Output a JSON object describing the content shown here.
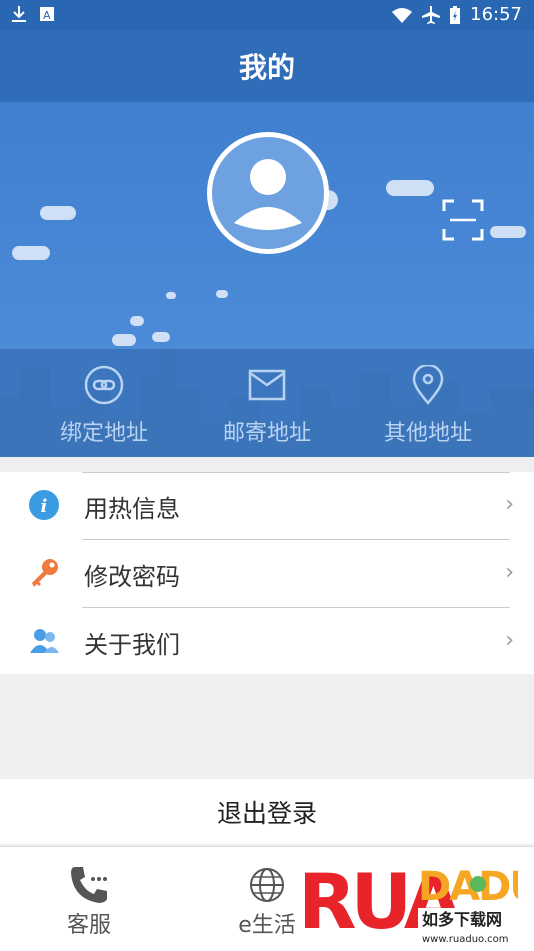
{
  "status_bar": {
    "time": "16:57",
    "icons": [
      "download-icon",
      "a-badge-icon",
      "wifi-icon",
      "airplane-icon",
      "battery-icon"
    ]
  },
  "header": {
    "title": "我的"
  },
  "hero": {
    "avatar_icon": "user-avatar-icon",
    "scan_icon": "scan-icon"
  },
  "address_tabs": [
    {
      "label": "绑定地址",
      "icon": "link-icon"
    },
    {
      "label": "邮寄地址",
      "icon": "mail-icon"
    },
    {
      "label": "其他地址",
      "icon": "location-pin-icon"
    }
  ],
  "menu": [
    {
      "label": "用热信息",
      "icon": "info-icon"
    },
    {
      "label": "修改密码",
      "icon": "key-icon"
    },
    {
      "label": "关于我们",
      "icon": "people-icon"
    }
  ],
  "logout_label": "退出登录",
  "tabbar": [
    {
      "label": "客服",
      "icon": "phone-icon"
    },
    {
      "label": "e生活",
      "icon": "globe-icon"
    }
  ],
  "watermark": {
    "brand": "RUANDADUO",
    "sub": "如多下载网",
    "url": "www.ruaduo.com"
  },
  "colors": {
    "primary": "#2f6db9",
    "hero": "#4a89d6",
    "menu_text": "#333333"
  }
}
